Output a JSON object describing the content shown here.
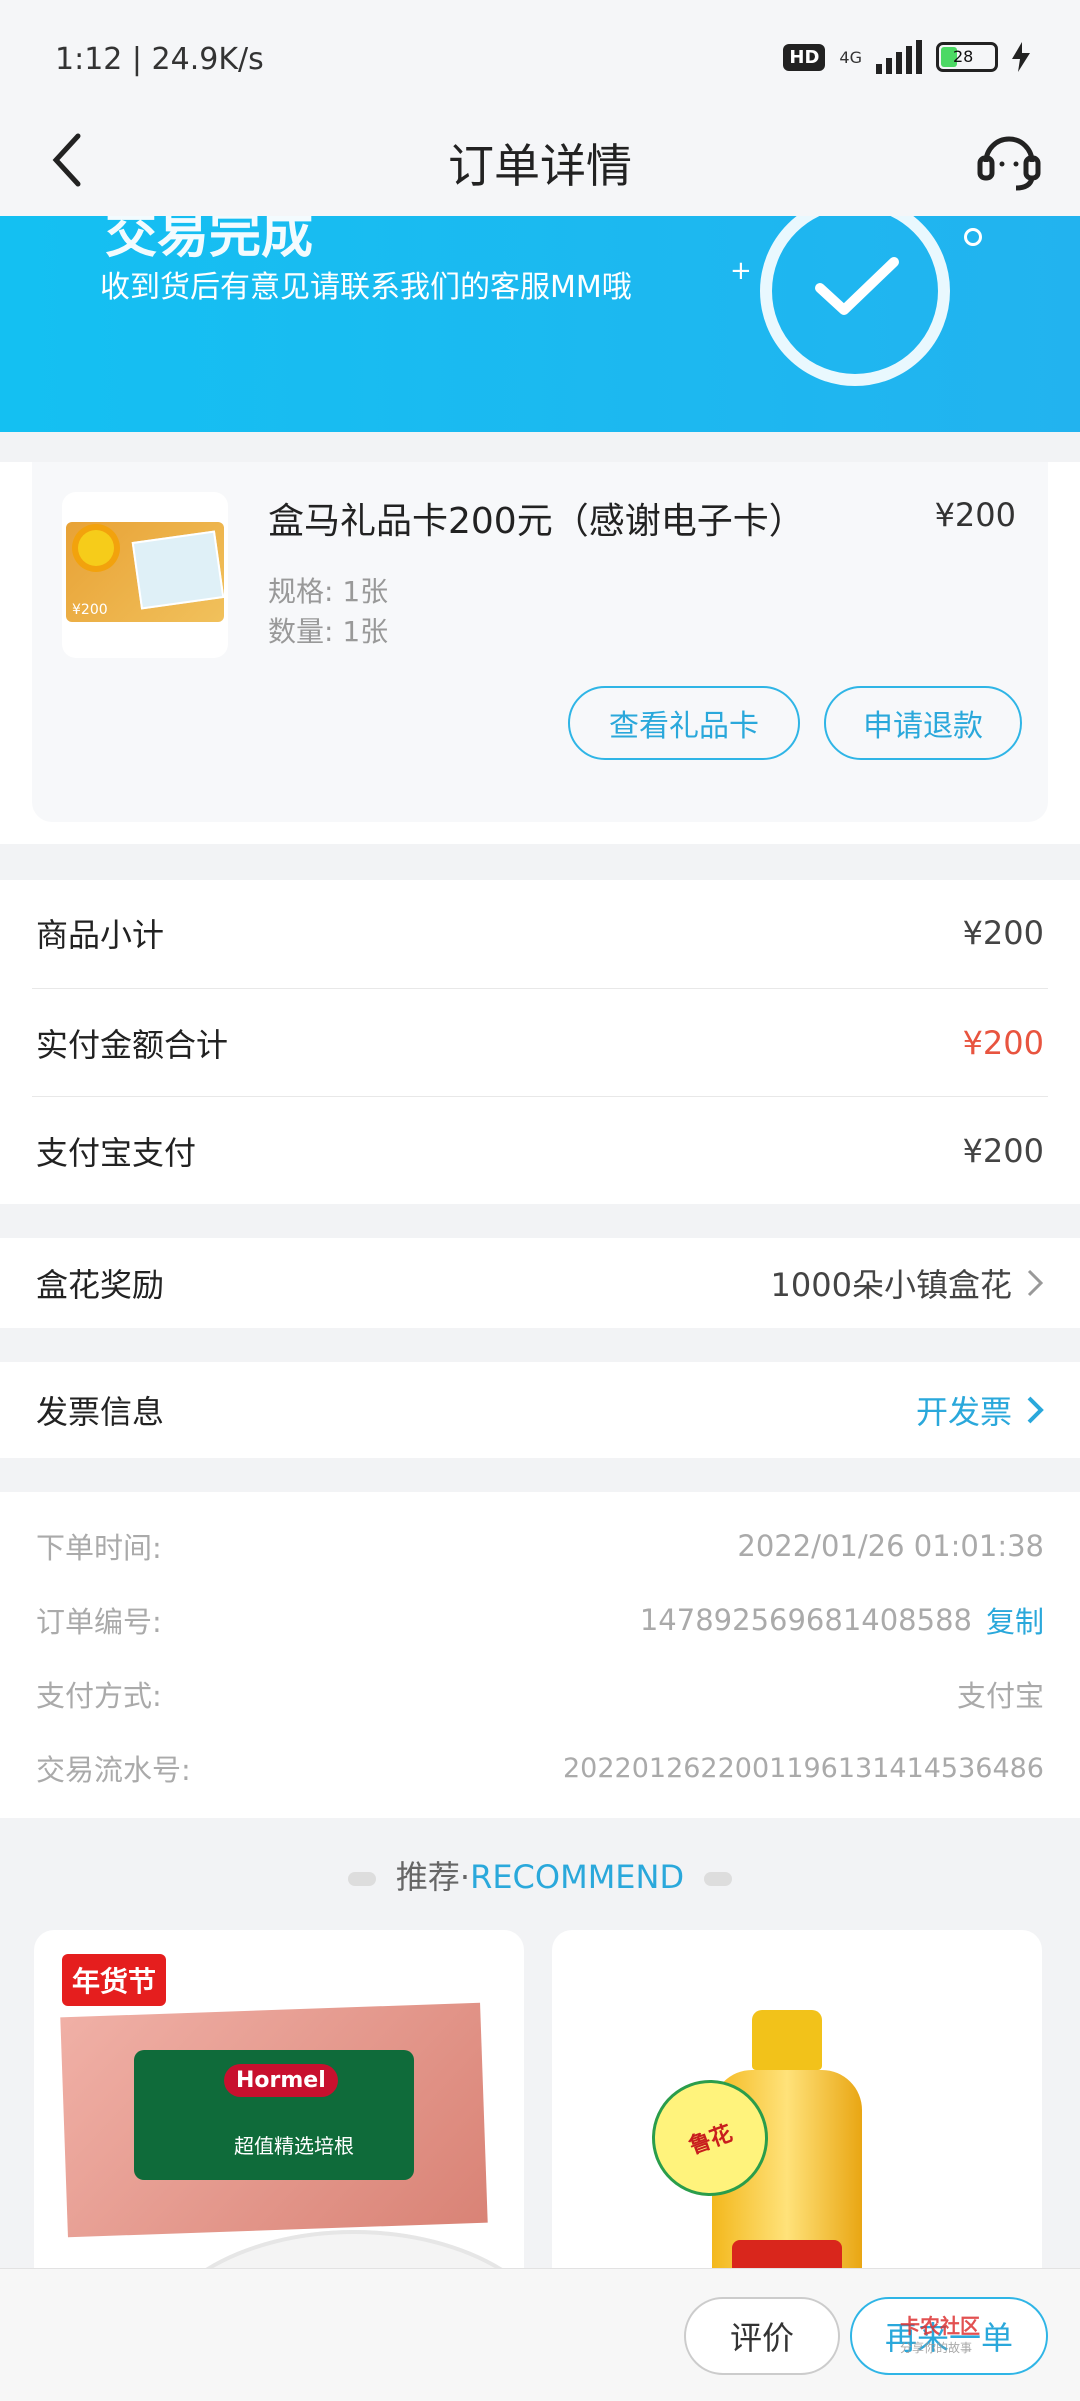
{
  "status_bar": {
    "time_speed": "1:12 | 24.9K/s",
    "hd": "HD",
    "network": "4G",
    "battery": "28"
  },
  "header": {
    "title": "订单详情"
  },
  "banner": {
    "headline": "交易完成",
    "message": "收到货后有意见请联系我们的客服MM哦"
  },
  "product": {
    "thumbnail_price": "¥200",
    "name": "盒马礼品卡200元（感谢电子卡）",
    "price": "¥200",
    "spec": "规格: 1张",
    "quantity": "数量: 1张",
    "view_card_button": "查看礼品卡",
    "refund_button": "申请退款"
  },
  "summary": {
    "subtotal_label": "商品小计",
    "subtotal_value": "¥200",
    "paid_label": "实付金额合计",
    "paid_value": "¥200",
    "method_label": "支付宝支付",
    "method_value": "¥200",
    "paid_color": "#e8543f"
  },
  "reward": {
    "label": "盒花奖励",
    "value": "1000朵小镇盒花"
  },
  "invoice": {
    "label": "发票信息",
    "action": "开发票"
  },
  "order_info": {
    "time_label": "下单时间:",
    "time_value": "2022/01/26 01:01:38",
    "number_label": "订单编号:",
    "number_value": "147892569681408588",
    "copy_label": "复制",
    "pay_method_label": "支付方式:",
    "pay_method_value": "支付宝",
    "serial_label": "交易流水号:",
    "serial_value": "2022012622001196131414536486"
  },
  "recommend": {
    "title_cn": "推荐·",
    "title_en": "RECOMMEND",
    "items": [
      {
        "badge": "年货节",
        "brand": "Hormel",
        "product_text": "超值精选培根"
      },
      {
        "tag": "鲁花",
        "label": "鲁花"
      }
    ]
  },
  "bottom_bar": {
    "review_button": "评价",
    "rebuy_button": "再来一单"
  },
  "watermark": {
    "title": "卡农社区",
    "sub": "分享你的故事"
  }
}
